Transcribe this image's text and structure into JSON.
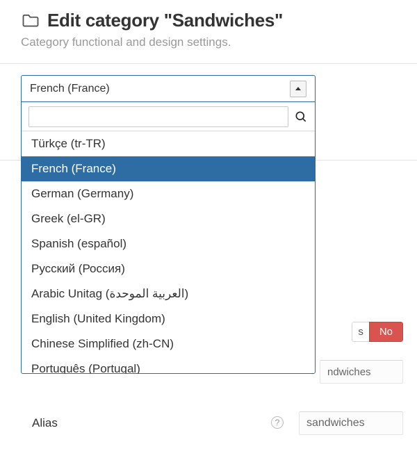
{
  "header": {
    "title": "Edit category \"Sandwiches\"",
    "subtitle": "Category functional and design settings."
  },
  "language_select": {
    "selected": "French (France)",
    "search_value": "",
    "options": [
      "Türkçe (tr-TR)",
      "French (France)",
      "German (Germany)",
      "Greek (el-GR)",
      "Spanish (español)",
      "Русский (Россия)",
      "Arabic Unitag (العربية الموحدة)",
      "English (United Kingdom)",
      "Chinese Simplified (zh-CN)",
      "Português (Portugal)"
    ],
    "selected_index": 1
  },
  "toggle": {
    "yes_label": "s",
    "no_label": "No"
  },
  "fields": {
    "title_value": "ndwiches",
    "alias_label": "Alias",
    "alias_value": "sandwiches"
  }
}
